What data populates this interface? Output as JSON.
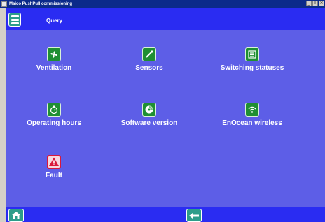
{
  "window": {
    "title": "Maico PushPull commissioning",
    "controls": [
      "_",
      "І",
      "×"
    ]
  },
  "header": {
    "title": "Query",
    "menu_icon": "list-menu-icon"
  },
  "tiles": [
    {
      "label": "Ventilation",
      "icon": "fan-icon"
    },
    {
      "label": "Sensors",
      "icon": "sensor-probe-icon"
    },
    {
      "label": "Switching statuses",
      "icon": "switch-list-icon"
    },
    {
      "label": "Operating hours",
      "icon": "stopwatch-icon"
    },
    {
      "label": "Software version",
      "icon": "disc-icon"
    },
    {
      "label": "EnOcean wireless",
      "icon": "wireless-icon"
    },
    {
      "label": "Fault",
      "icon": "warning-icon"
    }
  ],
  "footer": {
    "home_icon": "home-icon",
    "back_icon": "back-arrow-icon"
  },
  "colors": {
    "background": "#5d5ee7",
    "bar": "#2a2cf2",
    "button": "#2d9d8a",
    "icon_green": "#1f8f33",
    "fault_red": "#d9183b"
  }
}
